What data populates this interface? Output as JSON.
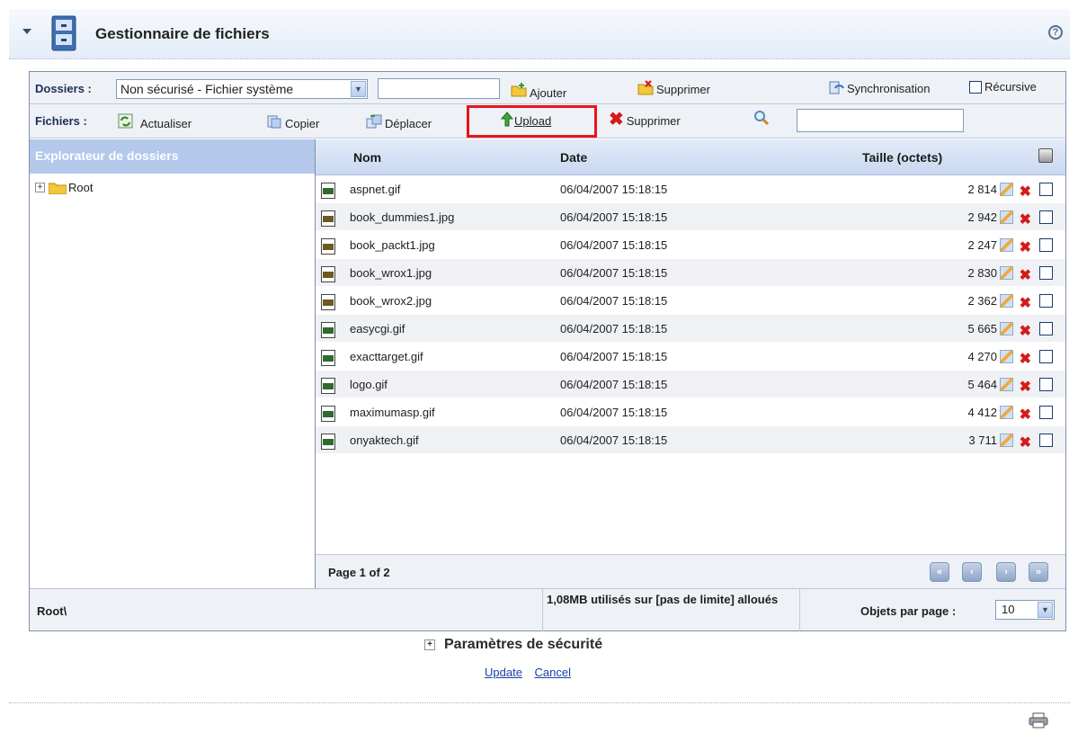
{
  "module": {
    "title": "Gestionnaire de fichiers",
    "help": "?"
  },
  "toolbar_dossiers": {
    "label": "Dossiers :",
    "folder_select": "Non sécurisé - Fichier système",
    "add": "Ajouter",
    "delete": "Supprimer",
    "sync": "Synchronisation",
    "recursive": "Récursive"
  },
  "toolbar_fichiers": {
    "label": "Fichiers :",
    "refresh": "Actualiser",
    "copy": "Copier",
    "move": "Déplacer",
    "upload": "Upload",
    "delete": "Supprimer"
  },
  "explorer": {
    "title": "Explorateur de dossiers",
    "root": "Root"
  },
  "grid": {
    "columns": {
      "name": "Nom",
      "date": "Date",
      "size": "Taille (octets)"
    },
    "rows": [
      {
        "name": "aspnet.gif",
        "type": "gif",
        "date": "06/04/2007 15:18:15",
        "size": "2 814"
      },
      {
        "name": "book_dummies1.jpg",
        "type": "jpg",
        "date": "06/04/2007 15:18:15",
        "size": "2 942"
      },
      {
        "name": "book_packt1.jpg",
        "type": "jpg",
        "date": "06/04/2007 15:18:15",
        "size": "2 247"
      },
      {
        "name": "book_wrox1.jpg",
        "type": "jpg",
        "date": "06/04/2007 15:18:15",
        "size": "2 830"
      },
      {
        "name": "book_wrox2.jpg",
        "type": "jpg",
        "date": "06/04/2007 15:18:15",
        "size": "2 362"
      },
      {
        "name": "easycgi.gif",
        "type": "gif",
        "date": "06/04/2007 15:18:15",
        "size": "5 665"
      },
      {
        "name": "exacttarget.gif",
        "type": "gif",
        "date": "06/04/2007 15:18:15",
        "size": "4 270"
      },
      {
        "name": "logo.gif",
        "type": "gif",
        "date": "06/04/2007 15:18:15",
        "size": "5 464"
      },
      {
        "name": "maximumasp.gif",
        "type": "gif",
        "date": "06/04/2007 15:18:15",
        "size": "4 412"
      },
      {
        "name": "onyaktech.gif",
        "type": "gif",
        "date": "06/04/2007 15:18:15",
        "size": "3 711"
      }
    ],
    "pagination": "Page 1 of 2"
  },
  "status": {
    "path": "Root\\",
    "usage": "1,08MB utilisés sur [pas de limite] alloués",
    "per_page_label": "Objets par page :",
    "per_page_value": "10"
  },
  "security": {
    "title": "Paramètres de sécurité",
    "update": "Update",
    "cancel": "Cancel"
  },
  "colors": {
    "highlight": "#e8151b",
    "header_blue": "#b3c8ea",
    "link": "#1a3fa8"
  }
}
